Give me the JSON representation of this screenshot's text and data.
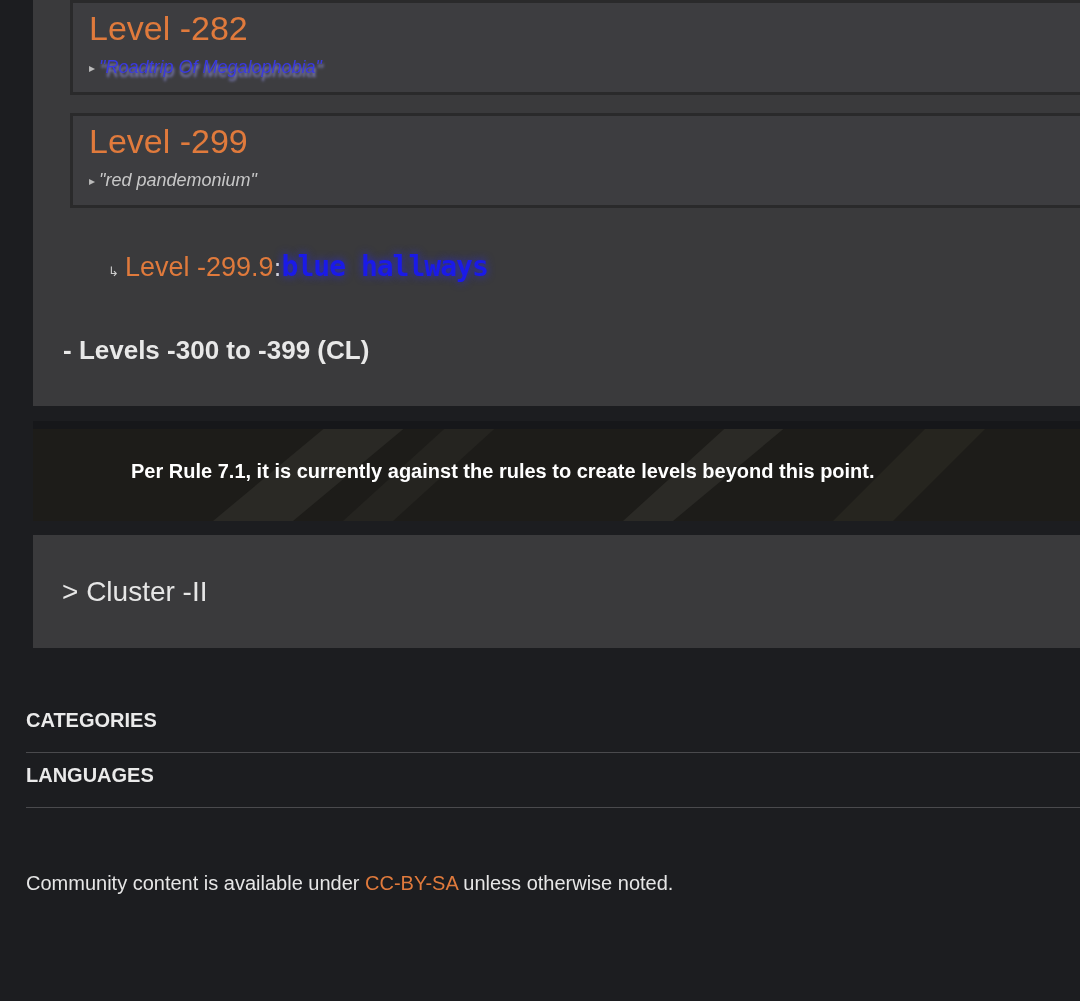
{
  "level_cards": [
    {
      "title": "Level -282",
      "marker": "▸",
      "quote": "\"Roadtrip Of Megalophobia\"",
      "kind": "glitch"
    },
    {
      "title": "Level -299",
      "marker": "▸",
      "quote": "\"red pandemonium\"",
      "kind": "plain"
    }
  ],
  "sublevel": {
    "arrow": "↳",
    "title": "Level -299.9",
    "separator": ":",
    "name": "blue hallways"
  },
  "range_heading": "- Levels -300 to -399 (CL)",
  "notice": "Per Rule 7.1, it is currently against the rules to create levels beyond this point.",
  "cluster": {
    "label": "> Cluster -II",
    "expanded": false
  },
  "footer_sections": [
    "CATEGORIES",
    "LANGUAGES"
  ],
  "license": {
    "prefix": "Community content is available under",
    "link": "CC-BY-SA",
    "suffix": "unless otherwise noted."
  }
}
